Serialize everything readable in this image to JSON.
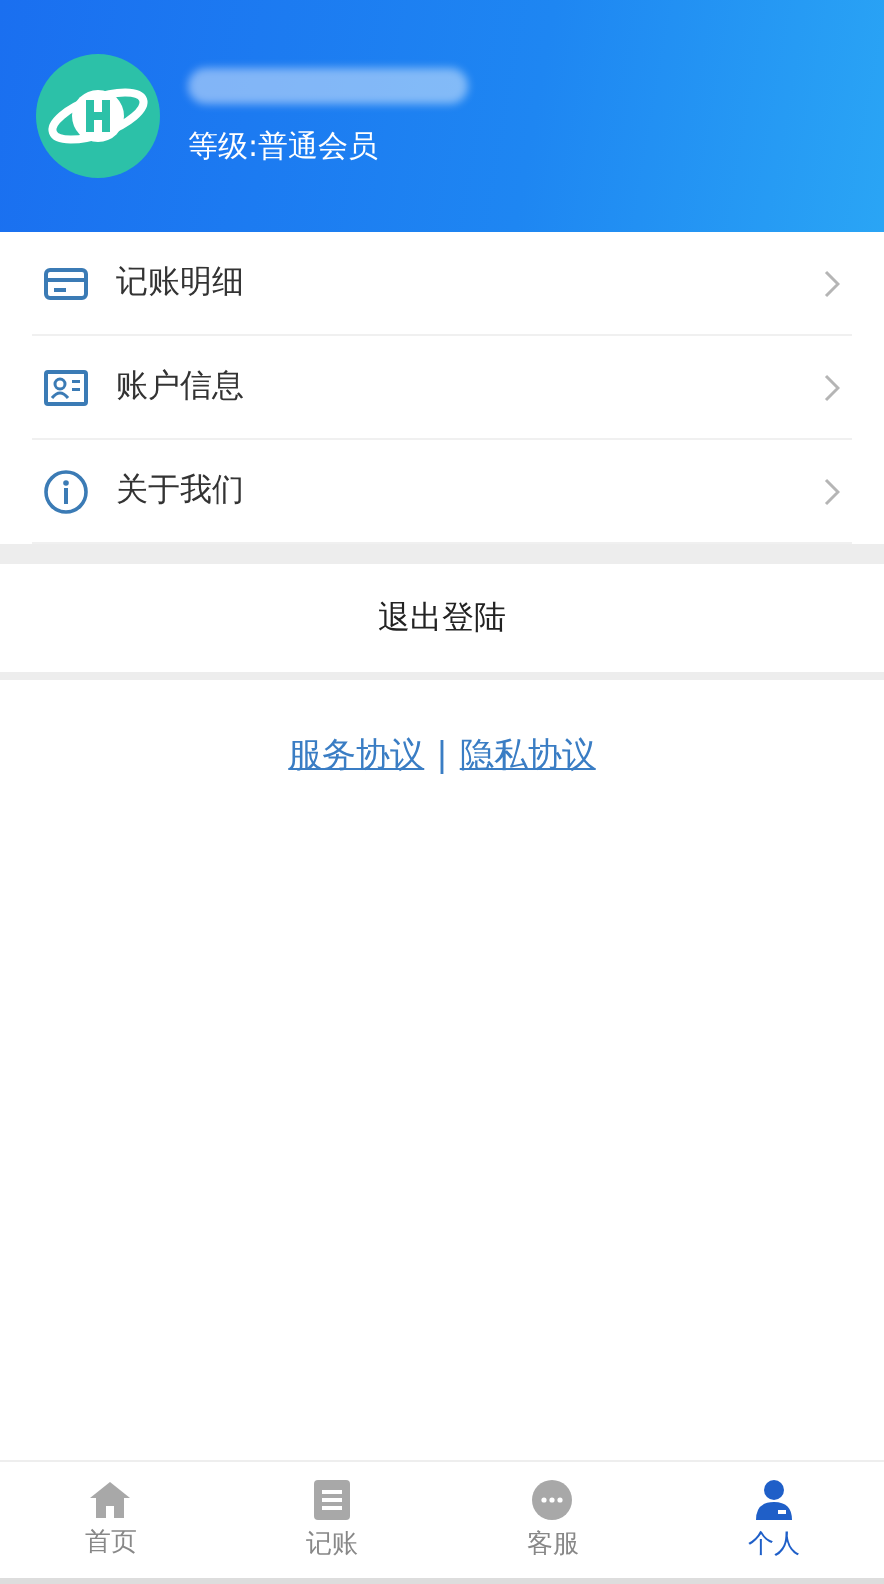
{
  "profile": {
    "level_text": "等级:普通会员"
  },
  "menu": [
    {
      "kind": "card",
      "label": "记账明细"
    },
    {
      "kind": "idcard",
      "label": "账户信息"
    },
    {
      "kind": "info",
      "label": "关于我们"
    }
  ],
  "logout": "退出登陆",
  "links": [
    {
      "label": "服务协议"
    },
    {
      "label": "隐私协议"
    }
  ],
  "link_separator": "|",
  "tabs": [
    {
      "kind": "home",
      "label": "首页",
      "selected": false
    },
    {
      "kind": "note",
      "label": "记账",
      "selected": false
    },
    {
      "kind": "chat",
      "label": "客服",
      "selected": false
    },
    {
      "kind": "person",
      "label": "个人",
      "selected": true
    }
  ]
}
